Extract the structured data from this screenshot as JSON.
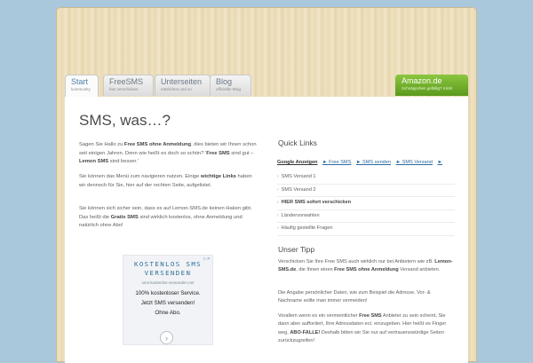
{
  "tabs": [
    {
      "label": "Start",
      "sub": "kommunity"
    },
    {
      "label": "FreeSMS",
      "sub": "hier verschicken"
    },
    {
      "label": "Unterseiten",
      "sub": "nützliches und so"
    },
    {
      "label": "Blog",
      "sub": "offizieller Blog"
    }
  ],
  "amazon_tab": {
    "label": "Amazon.de",
    "sub": "Schnäppchen gefällig? Klick!"
  },
  "main": {
    "title": "SMS, was…?",
    "p1": {
      "a": "Sagen Sie Hallo zu ",
      "b1": "Free SMS ohne Anmeldung",
      "c": ", dies bieten wir Ihnen schon seit einigen Jahren. Denn wie heißt es doch so schön? '",
      "b2": "Free SMS",
      "d": " sind gut – ",
      "b3": "Lemon SMS",
      "e": " sind besser.'"
    },
    "p2": {
      "a": "Sie können das Menü zum navigieren nutzen. Einige ",
      "b1": "wichtige Links",
      "c": " haben wir dennoch für Sie, hier auf der rechten Seite, aufgelistet."
    },
    "p3": {
      "a": "Sie können sich sicher sein, dass es auf Lemon-SMS.de keinen Haken gibt. Das heißt die ",
      "b1": "Gratis SMS",
      "c": " sind wirklich kostenlos, ohne Anmeldung und natürlich ohne Abo!"
    }
  },
  "ad": {
    "info_icon": "info-icon",
    "headline_1": "KOSTENLOS SMS",
    "headline_2": "VERSENDEN",
    "url": "sms-kostenlos-versenden.net",
    "body_1": "100% kostenloser Service.",
    "body_2": "Jetzt SMS versenden!",
    "body_3": "Ohne Abo.",
    "arrow": "›"
  },
  "quick_links": {
    "title": "Quick Links",
    "google_label": "Google Anzeigen",
    "ad_links": [
      "► Free SMS",
      "► SMS senden",
      "► SMS Versand",
      "►"
    ],
    "items": [
      "SMS Versand 1",
      "SMS Versand 2",
      "HIER SMS sofort verschicken",
      "Ländervorwahlen",
      "Häufig gestellte Fragen"
    ]
  },
  "tip": {
    "title": "Unser Tipp",
    "p1": {
      "a": "Verschicken Sie Ihre Free SMS auch wirklich nur bei Anbietern wie zB. ",
      "b1": "Lemon-SMS.de",
      "c": ", die Ihnen einen ",
      "b2": "Free SMS ohne Anmeldung",
      "d": " Versand anbieten."
    },
    "p2": "Die Angabe persönlicher Daten, wie zum Beispiel die Adresse, Vor- & Nachname sollte man immer vermeiden!",
    "p3": {
      "a": "Vorallem wenn es ein vermeintlicher ",
      "b1": "Free SMS",
      "c": " Anbieter zu sein scheint, Sie dann aber auffordert, Ihre Adressdaten ect. einzugeben. Hier heißt es Finger weg, ",
      "b2": "ABO-FALLE!",
      "d": " Deshalb bitten wir Sie nur auf vertrauenswürdige Seiten zurückzugreifen!"
    }
  }
}
